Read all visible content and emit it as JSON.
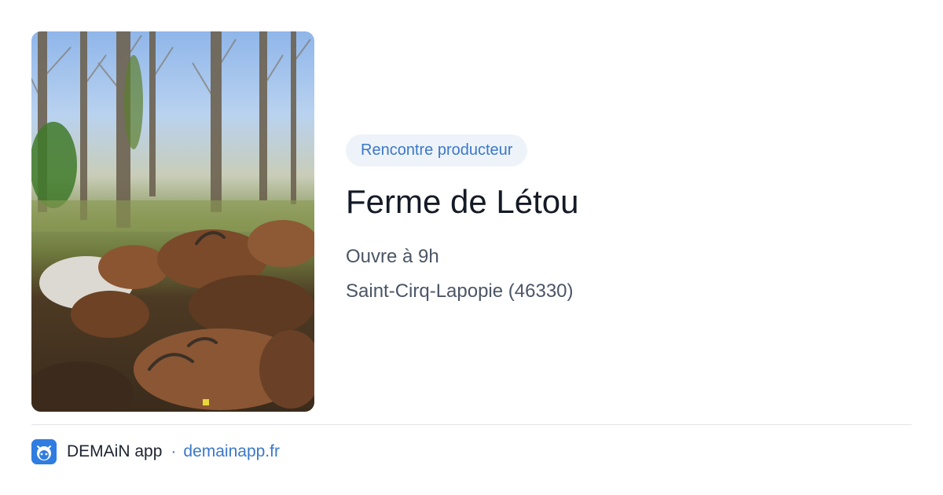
{
  "card": {
    "image": {
      "alt": "goat-herd-forest-photo"
    },
    "tag": "Rencontre producteur",
    "title": "Ferme de Létou",
    "hours": "Ouvre à 9h",
    "location": "Saint-Cirq-Lapopie (46330)"
  },
  "footer": {
    "app_icon": "demain-app-icon",
    "app_name": "DEMAiN app",
    "separator": "·",
    "domain": "demainapp.fr"
  },
  "colors": {
    "tag_bg": "#eef3fa",
    "accent": "#3a78c9",
    "title": "#141a26",
    "body_text": "#4b5566",
    "divider": "#dfe4ea",
    "app_icon_bg": "#2f7de1"
  }
}
